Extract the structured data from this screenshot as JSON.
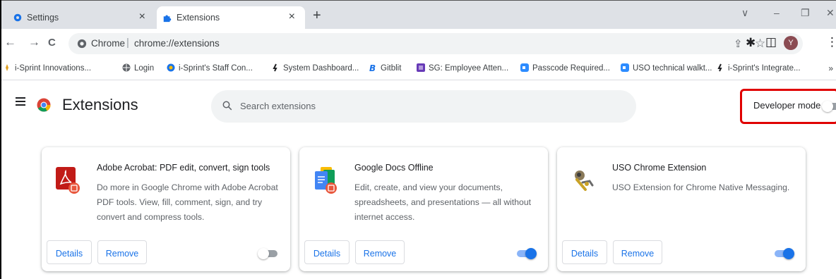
{
  "tabs": [
    {
      "title": "Settings",
      "close": "×",
      "icon": "gear-icon"
    },
    {
      "title": "Extensions",
      "close": "×",
      "icon": "puzzle-icon"
    }
  ],
  "new_tab": "+",
  "window_controls": {
    "minimize_down": "∨",
    "minimize": "–",
    "restore": "❐",
    "close": "✕"
  },
  "toolbar": {
    "back": "←",
    "forward": "→",
    "reload": "C",
    "site_label": "Chrome",
    "separator": "|",
    "url": "chrome://extensions",
    "share": "⇪",
    "star": "☆",
    "extensions": "✱",
    "side_panel": "◫",
    "profile_initial": "Y",
    "menu": "⋮"
  },
  "bookmarks": [
    {
      "label": "i-Sprint Innovations...",
      "icon": "isprint-icon",
      "color": "#e0a020"
    },
    {
      "label": "Login",
      "icon": "globe-icon",
      "color": "#5f6368"
    },
    {
      "label": "i-Sprint's Staff Con...",
      "icon": "staff-portal-icon",
      "color": "#1a73e8"
    },
    {
      "label": "System Dashboard...",
      "icon": "jira-runner-icon",
      "color": "#202124"
    },
    {
      "label": "Gitblit",
      "icon": "gitblit-icon",
      "color": "#1a73e8"
    },
    {
      "label": "SG: Employee Atten...",
      "icon": "form-icon",
      "color": "#673ab7"
    },
    {
      "label": "Passcode Required...",
      "icon": "zoom-icon",
      "color": "#2d8cff"
    },
    {
      "label": "USO technical walkt...",
      "icon": "zoom-icon",
      "color": "#2d8cff"
    },
    {
      "label": "i-Sprint's Integrate...",
      "icon": "jira-runner-icon",
      "color": "#202124"
    }
  ],
  "bookmarks_more": "»",
  "page": {
    "title": "Extensions",
    "search_placeholder": "Search extensions",
    "developer_mode_label": "Developer mode",
    "developer_mode_on": false
  },
  "extensions": [
    {
      "name": "Adobe Acrobat: PDF edit, convert, sign tools",
      "description": "Do more in Google Chrome with Adobe Acrobat PDF tools. View, fill, comment, sign, and try convert and compress tools.",
      "details_label": "Details",
      "remove_label": "Remove",
      "enabled": false,
      "icon": "acrobat-icon"
    },
    {
      "name": "Google Docs Offline",
      "description": "Edit, create, and view your documents, spreadsheets, and presentations — all without internet access.",
      "details_label": "Details",
      "remove_label": "Remove",
      "enabled": true,
      "icon": "docs-offline-icon"
    },
    {
      "name": "USO Chrome Extension",
      "description": "USO Extension for Chrome Native Messaging.",
      "details_label": "Details",
      "remove_label": "Remove",
      "enabled": true,
      "icon": "uso-extension-icon"
    }
  ],
  "colors": {
    "accent": "#1a73e8",
    "highlight_box": "#e00000",
    "tabstrip": "#dee1e6"
  }
}
